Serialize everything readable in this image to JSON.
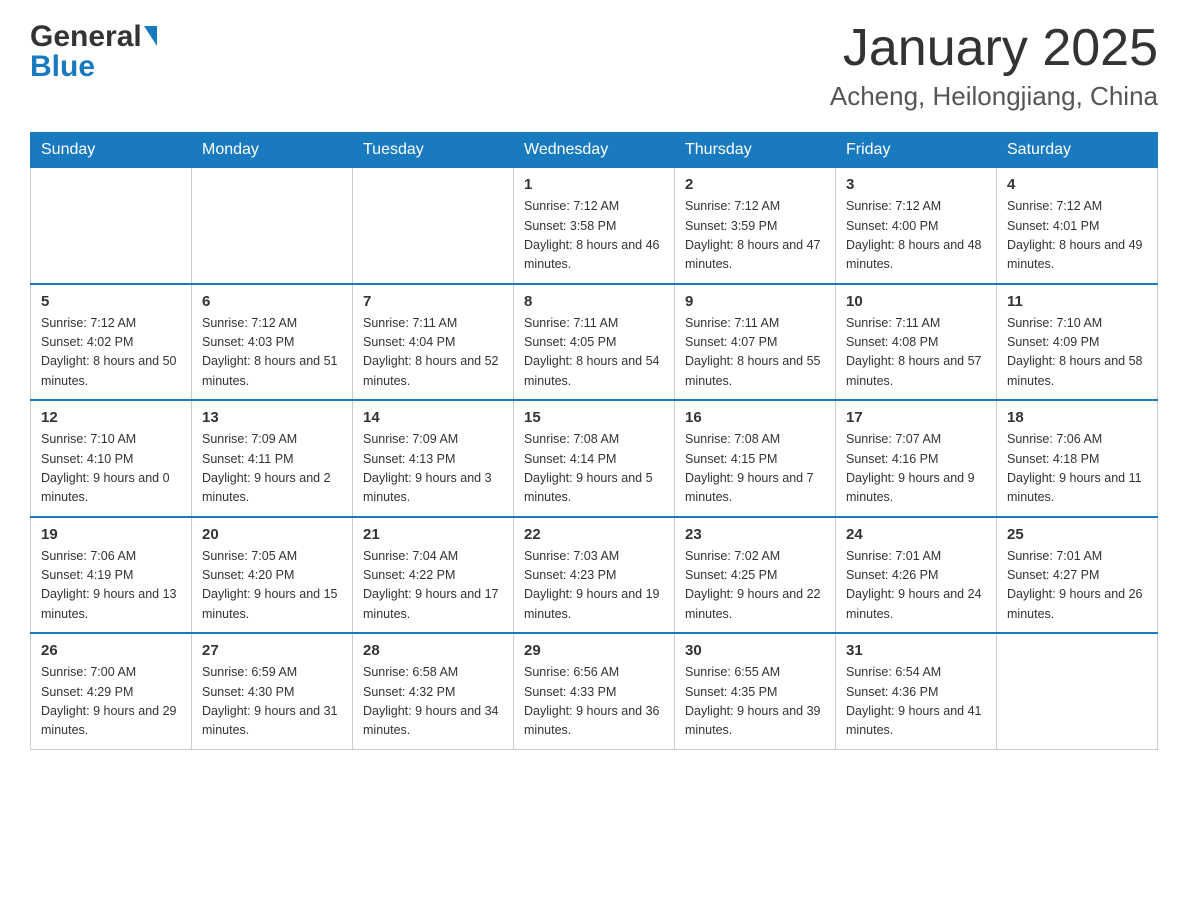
{
  "header": {
    "logo_general": "General",
    "logo_blue": "Blue",
    "title": "January 2025",
    "subtitle": "Acheng, Heilongjiang, China"
  },
  "weekdays": [
    "Sunday",
    "Monday",
    "Tuesday",
    "Wednesday",
    "Thursday",
    "Friday",
    "Saturday"
  ],
  "weeks": [
    [
      {
        "day": "",
        "info": ""
      },
      {
        "day": "",
        "info": ""
      },
      {
        "day": "",
        "info": ""
      },
      {
        "day": "1",
        "info": "Sunrise: 7:12 AM\nSunset: 3:58 PM\nDaylight: 8 hours\nand 46 minutes."
      },
      {
        "day": "2",
        "info": "Sunrise: 7:12 AM\nSunset: 3:59 PM\nDaylight: 8 hours\nand 47 minutes."
      },
      {
        "day": "3",
        "info": "Sunrise: 7:12 AM\nSunset: 4:00 PM\nDaylight: 8 hours\nand 48 minutes."
      },
      {
        "day": "4",
        "info": "Sunrise: 7:12 AM\nSunset: 4:01 PM\nDaylight: 8 hours\nand 49 minutes."
      }
    ],
    [
      {
        "day": "5",
        "info": "Sunrise: 7:12 AM\nSunset: 4:02 PM\nDaylight: 8 hours\nand 50 minutes."
      },
      {
        "day": "6",
        "info": "Sunrise: 7:12 AM\nSunset: 4:03 PM\nDaylight: 8 hours\nand 51 minutes."
      },
      {
        "day": "7",
        "info": "Sunrise: 7:11 AM\nSunset: 4:04 PM\nDaylight: 8 hours\nand 52 minutes."
      },
      {
        "day": "8",
        "info": "Sunrise: 7:11 AM\nSunset: 4:05 PM\nDaylight: 8 hours\nand 54 minutes."
      },
      {
        "day": "9",
        "info": "Sunrise: 7:11 AM\nSunset: 4:07 PM\nDaylight: 8 hours\nand 55 minutes."
      },
      {
        "day": "10",
        "info": "Sunrise: 7:11 AM\nSunset: 4:08 PM\nDaylight: 8 hours\nand 57 minutes."
      },
      {
        "day": "11",
        "info": "Sunrise: 7:10 AM\nSunset: 4:09 PM\nDaylight: 8 hours\nand 58 minutes."
      }
    ],
    [
      {
        "day": "12",
        "info": "Sunrise: 7:10 AM\nSunset: 4:10 PM\nDaylight: 9 hours\nand 0 minutes."
      },
      {
        "day": "13",
        "info": "Sunrise: 7:09 AM\nSunset: 4:11 PM\nDaylight: 9 hours\nand 2 minutes."
      },
      {
        "day": "14",
        "info": "Sunrise: 7:09 AM\nSunset: 4:13 PM\nDaylight: 9 hours\nand 3 minutes."
      },
      {
        "day": "15",
        "info": "Sunrise: 7:08 AM\nSunset: 4:14 PM\nDaylight: 9 hours\nand 5 minutes."
      },
      {
        "day": "16",
        "info": "Sunrise: 7:08 AM\nSunset: 4:15 PM\nDaylight: 9 hours\nand 7 minutes."
      },
      {
        "day": "17",
        "info": "Sunrise: 7:07 AM\nSunset: 4:16 PM\nDaylight: 9 hours\nand 9 minutes."
      },
      {
        "day": "18",
        "info": "Sunrise: 7:06 AM\nSunset: 4:18 PM\nDaylight: 9 hours\nand 11 minutes."
      }
    ],
    [
      {
        "day": "19",
        "info": "Sunrise: 7:06 AM\nSunset: 4:19 PM\nDaylight: 9 hours\nand 13 minutes."
      },
      {
        "day": "20",
        "info": "Sunrise: 7:05 AM\nSunset: 4:20 PM\nDaylight: 9 hours\nand 15 minutes."
      },
      {
        "day": "21",
        "info": "Sunrise: 7:04 AM\nSunset: 4:22 PM\nDaylight: 9 hours\nand 17 minutes."
      },
      {
        "day": "22",
        "info": "Sunrise: 7:03 AM\nSunset: 4:23 PM\nDaylight: 9 hours\nand 19 minutes."
      },
      {
        "day": "23",
        "info": "Sunrise: 7:02 AM\nSunset: 4:25 PM\nDaylight: 9 hours\nand 22 minutes."
      },
      {
        "day": "24",
        "info": "Sunrise: 7:01 AM\nSunset: 4:26 PM\nDaylight: 9 hours\nand 24 minutes."
      },
      {
        "day": "25",
        "info": "Sunrise: 7:01 AM\nSunset: 4:27 PM\nDaylight: 9 hours\nand 26 minutes."
      }
    ],
    [
      {
        "day": "26",
        "info": "Sunrise: 7:00 AM\nSunset: 4:29 PM\nDaylight: 9 hours\nand 29 minutes."
      },
      {
        "day": "27",
        "info": "Sunrise: 6:59 AM\nSunset: 4:30 PM\nDaylight: 9 hours\nand 31 minutes."
      },
      {
        "day": "28",
        "info": "Sunrise: 6:58 AM\nSunset: 4:32 PM\nDaylight: 9 hours\nand 34 minutes."
      },
      {
        "day": "29",
        "info": "Sunrise: 6:56 AM\nSunset: 4:33 PM\nDaylight: 9 hours\nand 36 minutes."
      },
      {
        "day": "30",
        "info": "Sunrise: 6:55 AM\nSunset: 4:35 PM\nDaylight: 9 hours\nand 39 minutes."
      },
      {
        "day": "31",
        "info": "Sunrise: 6:54 AM\nSunset: 4:36 PM\nDaylight: 9 hours\nand 41 minutes."
      },
      {
        "day": "",
        "info": ""
      }
    ]
  ]
}
